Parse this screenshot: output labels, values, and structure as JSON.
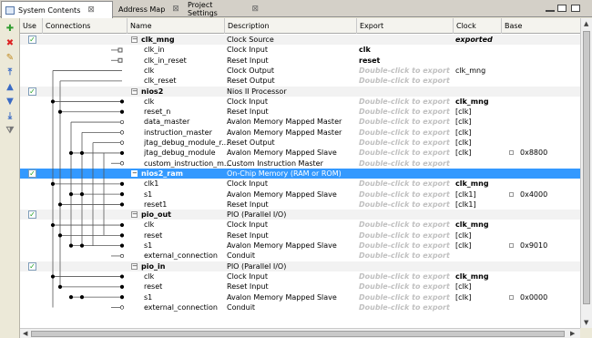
{
  "tabs": [
    {
      "label": "System Contents",
      "active": true
    },
    {
      "label": "Address Map",
      "active": false
    },
    {
      "label": "Project Settings",
      "active": false
    }
  ],
  "tab_close_glyph": "⊠",
  "columns": {
    "use": "Use",
    "connections": "Connections",
    "name": "Name",
    "description": "Description",
    "export": "Export",
    "clock": "Clock",
    "base": "Base"
  },
  "rows": [
    {
      "type": "module",
      "name": "clk_mng",
      "desc": "Clock Source",
      "export": "",
      "clock": "exported",
      "clockStyle": "italicb",
      "base": ""
    },
    {
      "type": "port",
      "name": "clk_in",
      "desc": "Clock Input",
      "export": "clk",
      "exportStyle": "bold",
      "clock": "",
      "base": ""
    },
    {
      "type": "port",
      "name": "clk_in_reset",
      "desc": "Reset Input",
      "export": "reset",
      "exportStyle": "bold",
      "clock": "",
      "base": ""
    },
    {
      "type": "port",
      "name": "clk",
      "desc": "Clock Output",
      "export": "Double-click to export",
      "exportStyle": "ghost",
      "clock": "clk_mng",
      "base": ""
    },
    {
      "type": "port",
      "name": "clk_reset",
      "desc": "Reset Output",
      "export": "Double-click to export",
      "exportStyle": "ghost",
      "clock": "",
      "base": ""
    },
    {
      "type": "module",
      "name": "nios2",
      "desc": "Nios II Processor",
      "export": "",
      "clock": "",
      "base": ""
    },
    {
      "type": "port",
      "name": "clk",
      "desc": "Clock Input",
      "export": "Double-click to export",
      "exportStyle": "ghost",
      "clock": "clk_mng",
      "clockStyle": "bold",
      "base": ""
    },
    {
      "type": "port",
      "name": "reset_n",
      "desc": "Reset Input",
      "export": "Double-click to export",
      "exportStyle": "ghost",
      "clock": "[clk]",
      "base": ""
    },
    {
      "type": "port",
      "name": "data_master",
      "desc": "Avalon Memory Mapped Master",
      "export": "Double-click to export",
      "exportStyle": "ghost",
      "clock": "[clk]",
      "base": ""
    },
    {
      "type": "port",
      "name": "instruction_master",
      "desc": "Avalon Memory Mapped Master",
      "export": "Double-click to export",
      "exportStyle": "ghost",
      "clock": "[clk]",
      "base": ""
    },
    {
      "type": "port",
      "name": "jtag_debug_module_r...",
      "desc": "Reset Output",
      "export": "Double-click to export",
      "exportStyle": "ghost",
      "clock": "[clk]",
      "base": ""
    },
    {
      "type": "port",
      "name": "jtag_debug_module",
      "desc": "Avalon Memory Mapped Slave",
      "export": "Double-click to export",
      "exportStyle": "ghost",
      "clock": "[clk]",
      "base": "0x8800"
    },
    {
      "type": "port",
      "name": "custom_instruction_m...",
      "desc": "Custom Instruction Master",
      "export": "Double-click to export",
      "exportStyle": "ghost",
      "clock": "",
      "base": ""
    },
    {
      "type": "module",
      "name": "nios2_ram",
      "desc": "On-Chip Memory (RAM or ROM)",
      "export": "",
      "clock": "",
      "base": "",
      "selected": true
    },
    {
      "type": "port",
      "name": "clk1",
      "desc": "Clock Input",
      "export": "Double-click to export",
      "exportStyle": "ghost",
      "clock": "clk_mng",
      "clockStyle": "bold",
      "base": ""
    },
    {
      "type": "port",
      "name": "s1",
      "desc": "Avalon Memory Mapped Slave",
      "export": "Double-click to export",
      "exportStyle": "ghost",
      "clock": "[clk1]",
      "base": "0x4000"
    },
    {
      "type": "port",
      "name": "reset1",
      "desc": "Reset Input",
      "export": "Double-click to export",
      "exportStyle": "ghost",
      "clock": "[clk1]",
      "base": ""
    },
    {
      "type": "module",
      "name": "pio_out",
      "desc": "PIO (Parallel I/O)",
      "export": "",
      "clock": "",
      "base": ""
    },
    {
      "type": "port",
      "name": "clk",
      "desc": "Clock Input",
      "export": "Double-click to export",
      "exportStyle": "ghost",
      "clock": "clk_mng",
      "clockStyle": "bold",
      "base": ""
    },
    {
      "type": "port",
      "name": "reset",
      "desc": "Reset Input",
      "export": "Double-click to export",
      "exportStyle": "ghost",
      "clock": "[clk]",
      "base": ""
    },
    {
      "type": "port",
      "name": "s1",
      "desc": "Avalon Memory Mapped Slave",
      "export": "Double-click to export",
      "exportStyle": "ghost",
      "clock": "[clk]",
      "base": "0x9010"
    },
    {
      "type": "port",
      "name": "external_connection",
      "desc": "Conduit",
      "export": "Double-click to export",
      "exportStyle": "ghost",
      "clock": "",
      "base": ""
    },
    {
      "type": "module",
      "name": "pio_in",
      "desc": "PIO (Parallel I/O)",
      "export": "",
      "clock": "",
      "base": ""
    },
    {
      "type": "port",
      "name": "clk",
      "desc": "Clock Input",
      "export": "Double-click to export",
      "exportStyle": "ghost",
      "clock": "clk_mng",
      "clockStyle": "bold",
      "base": ""
    },
    {
      "type": "port",
      "name": "reset",
      "desc": "Reset Input",
      "export": "Double-click to export",
      "exportStyle": "ghost",
      "clock": "[clk]",
      "base": ""
    },
    {
      "type": "port",
      "name": "s1",
      "desc": "Avalon Memory Mapped Slave",
      "export": "Double-click to export",
      "exportStyle": "ghost",
      "clock": "[clk]",
      "base": "0x0000"
    },
    {
      "type": "port",
      "name": "external_connection",
      "desc": "Conduit",
      "export": "Double-click to export",
      "exportStyle": "ghost",
      "clock": "",
      "base": ""
    }
  ],
  "toolbar_icons": [
    "add-icon",
    "remove-icon",
    "edit-icon",
    "move-up-icon",
    "move-up-icon",
    "move-down-icon",
    "move-bottom-icon",
    "filter-icon"
  ],
  "colors": {
    "selection": "#3399ff",
    "ghost": "#c0c0c0",
    "accent_check": "#21a121"
  }
}
